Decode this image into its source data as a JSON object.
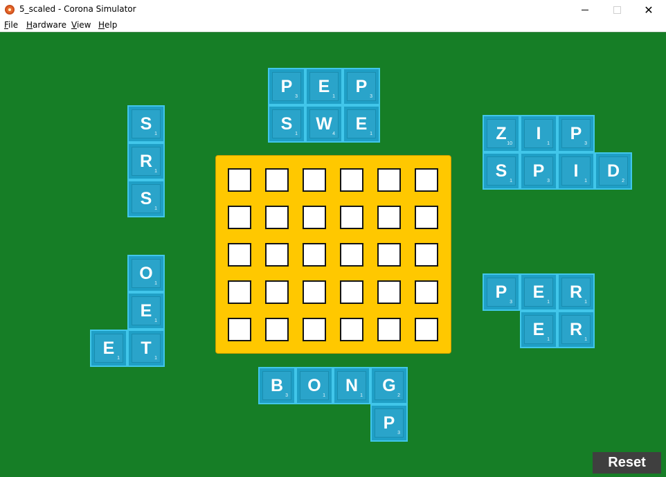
{
  "window": {
    "title": "5_scaled - Corona Simulator",
    "minimize_symbol": "",
    "maximize_symbol": "",
    "close_symbol": "✕",
    "icon": "corona-app-icon"
  },
  "menu": [
    {
      "label": "File",
      "mnemonic": "F",
      "rest": "ile"
    },
    {
      "label": "Hardware",
      "mnemonic": "H",
      "rest": "ardware"
    },
    {
      "label": "View",
      "mnemonic": "V",
      "rest": "iew"
    },
    {
      "label": "Help",
      "mnemonic": "H",
      "rest": "elp"
    }
  ],
  "colors": {
    "background": "#167e26",
    "board": "#ffc800",
    "tile": "#1f9fc6",
    "tile_border": "#41c6ea",
    "reset_button": "#3f3f3f"
  },
  "board": {
    "rows": 5,
    "columns": 6,
    "cells_filled": 0
  },
  "tiles": [
    {
      "letter": "P",
      "score": "3"
    },
    {
      "letter": "E",
      "score": "1"
    },
    {
      "letter": "P",
      "score": "3"
    },
    {
      "letter": "S",
      "score": "1"
    },
    {
      "letter": "W",
      "score": "4"
    },
    {
      "letter": "E",
      "score": "1"
    },
    {
      "letter": "S",
      "score": "1"
    },
    {
      "letter": "R",
      "score": "1"
    },
    {
      "letter": "S",
      "score": "1"
    },
    {
      "letter": "Z",
      "score": "10"
    },
    {
      "letter": "I",
      "score": "1"
    },
    {
      "letter": "P",
      "score": "3"
    },
    {
      "letter": "S",
      "score": "1"
    },
    {
      "letter": "P",
      "score": "3"
    },
    {
      "letter": "I",
      "score": "1"
    },
    {
      "letter": "D",
      "score": "2"
    },
    {
      "letter": "O",
      "score": "1"
    },
    {
      "letter": "E",
      "score": "1"
    },
    {
      "letter": "E",
      "score": "1"
    },
    {
      "letter": "T",
      "score": "1"
    },
    {
      "letter": "P",
      "score": "3"
    },
    {
      "letter": "E",
      "score": "1"
    },
    {
      "letter": "R",
      "score": "1"
    },
    {
      "letter": "E",
      "score": "1"
    },
    {
      "letter": "R",
      "score": "1"
    },
    {
      "letter": "B",
      "score": "3"
    },
    {
      "letter": "O",
      "score": "1"
    },
    {
      "letter": "N",
      "score": "1"
    },
    {
      "letter": "G",
      "score": "2"
    },
    {
      "letter": "P",
      "score": "3"
    }
  ],
  "reset_label": "Reset"
}
